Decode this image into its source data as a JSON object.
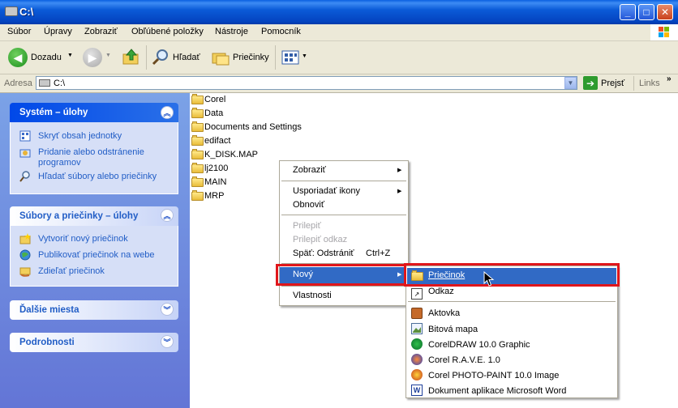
{
  "window": {
    "title": "C:\\"
  },
  "menubar": [
    "Súbor",
    "Úpravy",
    "Zobraziť",
    "Obľúbené položky",
    "Nástroje",
    "Pomocník"
  ],
  "toolbar": {
    "back": "Dozadu",
    "search": "Hľadať",
    "folders": "Priečinky"
  },
  "address": {
    "label": "Adresa",
    "value": "C:\\",
    "go": "Prejsť",
    "links": "Links"
  },
  "taskpane": {
    "system": {
      "title": "Systém – úlohy",
      "items": [
        "Skryť obsah jednotky",
        "Pridanie alebo odstránenie programov",
        "Hľadať súbory alebo priečinky"
      ]
    },
    "files": {
      "title": "Súbory a priečinky – úlohy",
      "items": [
        "Vytvoriť nový priečinok",
        "Publikovať priečinok na webe",
        "Zdieľať priečinok"
      ]
    },
    "other": {
      "title": "Ďalšie miesta"
    },
    "details": {
      "title": "Podrobnosti"
    }
  },
  "folders": [
    "Corel",
    "Data",
    "Documents and Settings",
    "edifact",
    "K_DISK.MAP",
    "lj2100",
    "MAIN",
    "MRP"
  ],
  "context_menu": {
    "view": "Zobraziť",
    "arrange": "Usporiadať ikony",
    "refresh": "Obnoviť",
    "paste": "Prilepiť",
    "paste_link": "Prilepiť odkaz",
    "undo": "Späť: Odstrániť",
    "undo_shortcut": "Ctrl+Z",
    "new": "Nový",
    "properties": "Vlastnosti"
  },
  "submenu": [
    "Priečinok",
    "Odkaz",
    "Aktovka",
    "Bitová mapa",
    "CorelDRAW 10.0 Graphic",
    "Corel R.A.V.E. 1.0",
    "Corel PHOTO-PAINT 10.0 Image",
    "Dokument aplikace Microsoft Word"
  ],
  "colors": {
    "highlight": "#316ac5",
    "redbox": "#e0161b",
    "titlebar": "#0444c0"
  }
}
